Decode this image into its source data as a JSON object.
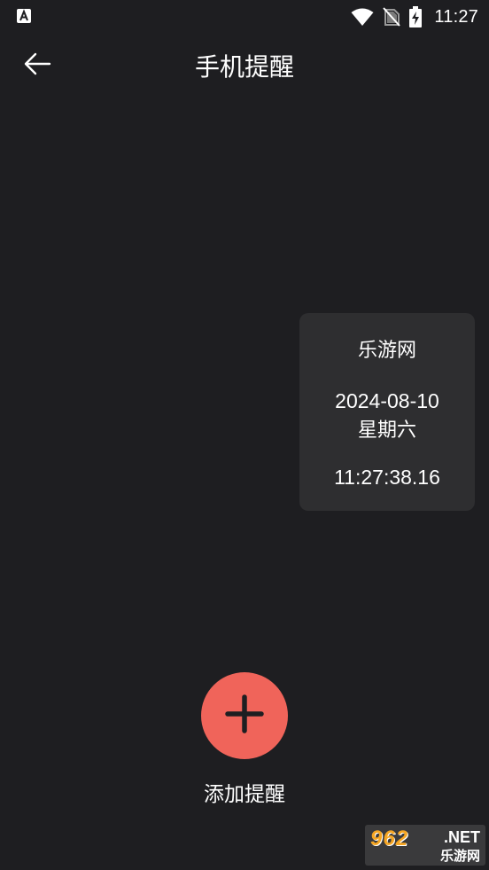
{
  "status_bar": {
    "left_icon": "text-a-icon",
    "icons": [
      "wifi-icon",
      "no-sim-icon",
      "battery-charging-icon"
    ],
    "time": "11:27"
  },
  "app_bar": {
    "back_icon": "arrow-left-icon",
    "title": "手机提醒"
  },
  "clock_card": {
    "brand": "乐游网",
    "date": "2024-08-10",
    "weekday": "星期六",
    "time": "11:27:38.16"
  },
  "add_reminder": {
    "icon": "plus-icon",
    "label": "添加提醒"
  },
  "watermark": {
    "top": "962",
    "net": ".NET",
    "cn": "乐游网"
  },
  "colors": {
    "background": "#1e1e21",
    "card": "#2e2e30",
    "accent": "#f0645a"
  }
}
